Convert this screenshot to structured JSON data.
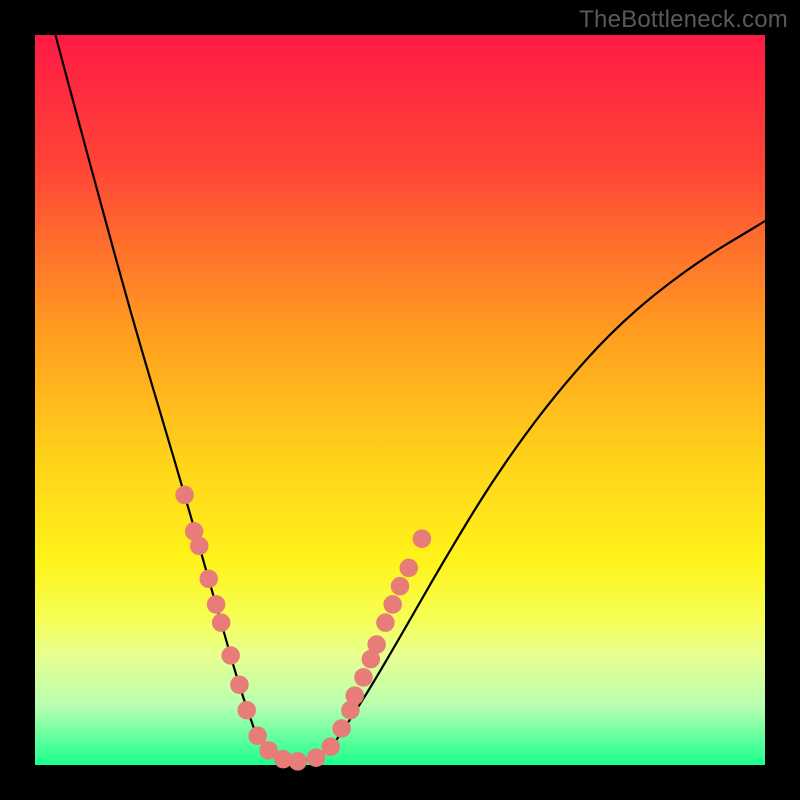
{
  "watermark": "TheBottleneck.com",
  "colors": {
    "frame": "#000000",
    "curve": "#000000",
    "marker": "#e77c78",
    "gradient_stops": [
      {
        "pct": 0,
        "color": "#ff1a45"
      },
      {
        "pct": 18,
        "color": "#ff4537"
      },
      {
        "pct": 40,
        "color": "#ff9a20"
      },
      {
        "pct": 58,
        "color": "#ffd21a"
      },
      {
        "pct": 72,
        "color": "#fff31a"
      },
      {
        "pct": 80,
        "color": "#f5ff55"
      },
      {
        "pct": 85,
        "color": "#e8ff90"
      },
      {
        "pct": 92,
        "color": "#b6ffb0"
      },
      {
        "pct": 100,
        "color": "#1aff8c"
      }
    ]
  },
  "chart_data": {
    "type": "line",
    "title": "",
    "xlabel": "",
    "ylabel": "",
    "xlim": [
      0,
      1
    ],
    "ylim": [
      0,
      1
    ],
    "note": "Axes are not labeled in the source image; x/y are normalized 0..1 within the gradient panel, y increases upward. Curve is a V-shaped bottleneck profile.",
    "series": [
      {
        "name": "left-branch",
        "x": [
          0.028,
          0.06,
          0.09,
          0.12,
          0.15,
          0.18,
          0.205,
          0.225,
          0.242,
          0.258,
          0.272,
          0.286,
          0.3
        ],
        "y": [
          1.0,
          0.88,
          0.77,
          0.66,
          0.555,
          0.455,
          0.37,
          0.3,
          0.24,
          0.185,
          0.135,
          0.09,
          0.05
        ]
      },
      {
        "name": "trough",
        "x": [
          0.3,
          0.32,
          0.34,
          0.36,
          0.385,
          0.41
        ],
        "y": [
          0.05,
          0.02,
          0.008,
          0.005,
          0.01,
          0.03
        ]
      },
      {
        "name": "right-branch",
        "x": [
          0.41,
          0.45,
          0.5,
          0.56,
          0.63,
          0.71,
          0.8,
          0.9,
          1.0
        ],
        "y": [
          0.03,
          0.09,
          0.175,
          0.28,
          0.395,
          0.505,
          0.605,
          0.685,
          0.745
        ]
      }
    ],
    "markers": {
      "name": "highlighted-points",
      "color": "#e77c78",
      "r": 0.012,
      "points": [
        {
          "x": 0.205,
          "y": 0.37
        },
        {
          "x": 0.218,
          "y": 0.32
        },
        {
          "x": 0.225,
          "y": 0.3
        },
        {
          "x": 0.238,
          "y": 0.255
        },
        {
          "x": 0.248,
          "y": 0.22
        },
        {
          "x": 0.255,
          "y": 0.195
        },
        {
          "x": 0.268,
          "y": 0.15
        },
        {
          "x": 0.28,
          "y": 0.11
        },
        {
          "x": 0.29,
          "y": 0.075
        },
        {
          "x": 0.305,
          "y": 0.04
        },
        {
          "x": 0.32,
          "y": 0.02
        },
        {
          "x": 0.34,
          "y": 0.008
        },
        {
          "x": 0.36,
          "y": 0.005
        },
        {
          "x": 0.385,
          "y": 0.01
        },
        {
          "x": 0.405,
          "y": 0.025
        },
        {
          "x": 0.42,
          "y": 0.05
        },
        {
          "x": 0.432,
          "y": 0.075
        },
        {
          "x": 0.438,
          "y": 0.095
        },
        {
          "x": 0.45,
          "y": 0.12
        },
        {
          "x": 0.46,
          "y": 0.145
        },
        {
          "x": 0.468,
          "y": 0.165
        },
        {
          "x": 0.48,
          "y": 0.195
        },
        {
          "x": 0.49,
          "y": 0.22
        },
        {
          "x": 0.5,
          "y": 0.245
        },
        {
          "x": 0.512,
          "y": 0.27
        },
        {
          "x": 0.53,
          "y": 0.31
        }
      ]
    }
  }
}
